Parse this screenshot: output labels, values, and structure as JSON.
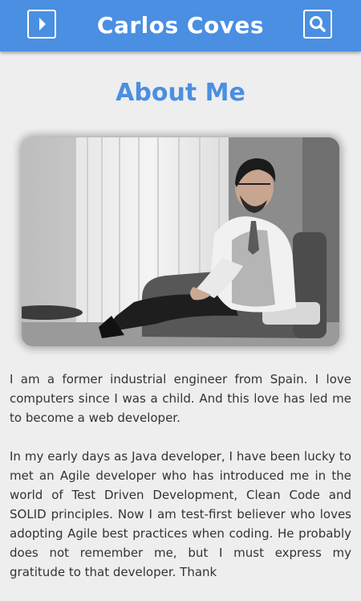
{
  "header": {
    "title": "Carlos Coves",
    "menu_icon": "caret-right-icon",
    "search_icon": "search-icon",
    "color": "#4a8fe2"
  },
  "main": {
    "heading": "About Me",
    "paragraphs": [
      "I am a former industrial engineer from Spain. I love computers since I was a child. And this love has led me to become a web developer.",
      "In my early days as Java developer, I have been lucky to met an Agile developer who has introduced me in the world of Test Driven Development, Clean Code and SOLID principles. Now I am test-first believer who loves adopting Agile best practices when coding. He probably does not remember me, but I must express my gratitude to that developer. Thank"
    ]
  }
}
